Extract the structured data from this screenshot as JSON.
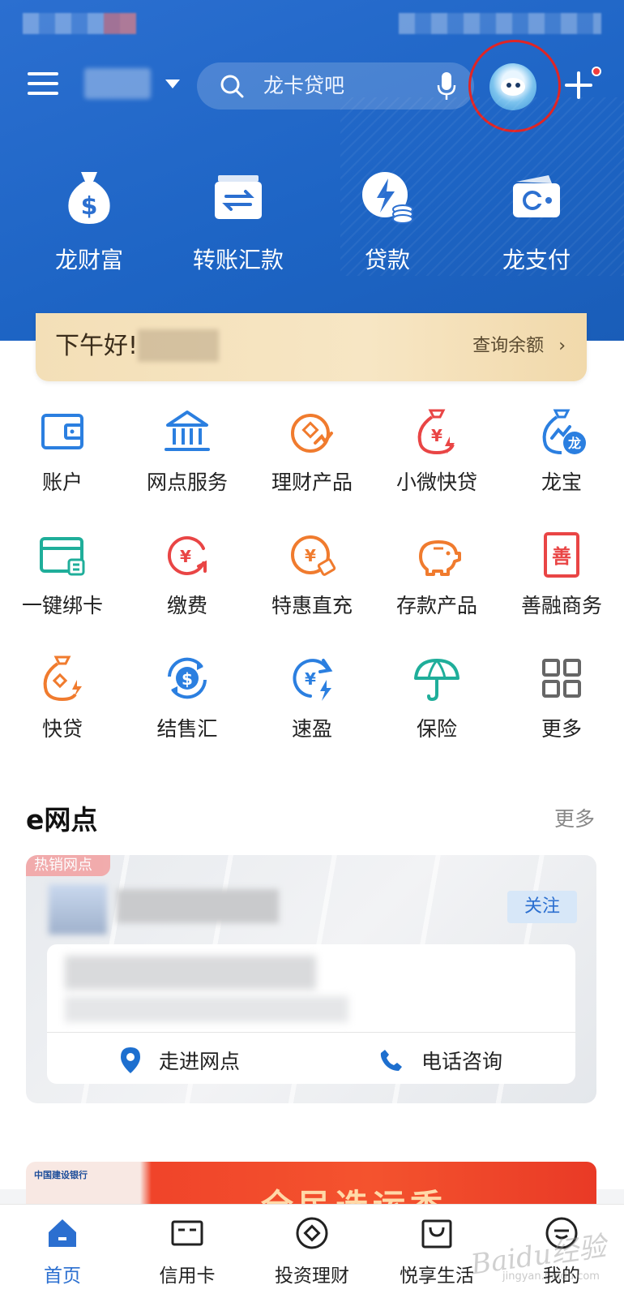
{
  "header": {
    "search_placeholder": "龙卡贷吧",
    "quick_actions": [
      {
        "label": "龙财富",
        "icon": "money-bag-icon"
      },
      {
        "label": "转账汇款",
        "icon": "transfer-icon"
      },
      {
        "label": "贷款",
        "icon": "loan-icon"
      },
      {
        "label": "龙支付",
        "icon": "wallet-pay-icon"
      }
    ]
  },
  "greeting": {
    "text": "下午好!",
    "balance_link": "查询余额"
  },
  "services": [
    {
      "label": "账户",
      "icon": "wallet-icon",
      "color": "#2b7fe0"
    },
    {
      "label": "网点服务",
      "icon": "bank-building-icon",
      "color": "#2b7fe0"
    },
    {
      "label": "理财产品",
      "icon": "finance-product-icon",
      "color": "#f07b2e"
    },
    {
      "label": "小微快贷",
      "icon": "small-loan-icon",
      "color": "#e94545"
    },
    {
      "label": "龙宝",
      "icon": "long-bao-icon",
      "color": "#2b7fe0"
    },
    {
      "label": "一键绑卡",
      "icon": "bind-card-icon",
      "color": "#1fae9a"
    },
    {
      "label": "缴费",
      "icon": "payment-icon",
      "color": "#e94545"
    },
    {
      "label": "特惠直充",
      "icon": "recharge-icon",
      "color": "#f07b2e"
    },
    {
      "label": "存款产品",
      "icon": "piggy-bank-icon",
      "color": "#f07b2e"
    },
    {
      "label": "善融商务",
      "icon": "shanrong-icon",
      "color": "#e94545"
    },
    {
      "label": "快贷",
      "icon": "quick-loan-icon",
      "color": "#f07b2e"
    },
    {
      "label": "结售汇",
      "icon": "exchange-icon",
      "color": "#2b7fe0"
    },
    {
      "label": "速盈",
      "icon": "suying-icon",
      "color": "#2b7fe0"
    },
    {
      "label": "保险",
      "icon": "umbrella-icon",
      "color": "#1fae9a"
    },
    {
      "label": "更多",
      "icon": "more-grid-icon",
      "color": "#666666"
    }
  ],
  "eoutlet": {
    "title": "e网点",
    "more": "更多",
    "hot_tag": "热销网点",
    "follow": "关注",
    "enter": "走进网点",
    "call": "电话咨询"
  },
  "banner": {
    "logo": "中国建设银行",
    "text": "全民选运香"
  },
  "tabs": [
    {
      "label": "首页",
      "icon": "home-icon",
      "active": true
    },
    {
      "label": "信用卡",
      "icon": "credit-card-icon",
      "active": false
    },
    {
      "label": "投资理财",
      "icon": "invest-icon",
      "active": false
    },
    {
      "label": "悦享生活",
      "icon": "shopping-bag-icon",
      "active": false
    },
    {
      "label": "我的",
      "icon": "profile-icon",
      "active": false
    }
  ],
  "watermark": "Baidu经验",
  "watermark_sub": "jingyan.baidu.com"
}
